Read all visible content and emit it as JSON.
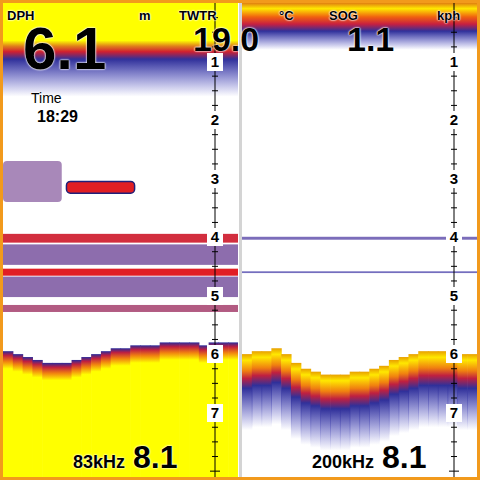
{
  "readouts": [
    {
      "label": "DPH",
      "value": "6.1",
      "unit": "m"
    },
    {
      "label": "TWTR",
      "value": "19.0",
      "unit": "°C"
    },
    {
      "label": "SOG",
      "value": "1.1",
      "unit": "kph"
    }
  ],
  "time": {
    "label": "Time",
    "value": "18:29"
  },
  "panels": [
    {
      "frequency": "83kHz",
      "range": "8.1",
      "scale": [
        "1",
        "2",
        "3",
        "4",
        "5",
        "6",
        "7"
      ],
      "surface_depth": 1.6,
      "bottom": [
        5.95,
        6.0,
        6.05,
        6.1,
        6.15,
        6.15,
        6.15,
        6.1,
        6.05,
        6.0,
        5.95,
        5.9,
        5.9,
        5.85,
        5.85,
        5.85,
        5.8,
        5.8,
        5.8,
        5.8,
        5.85,
        5.8,
        5.8,
        5.8
      ],
      "bottom_thickness": 2.5,
      "layers": [
        {
          "depth": 4.02,
          "thickness": 0.15,
          "strength": 0.9
        },
        {
          "depth": 4.3,
          "thickness": 0.35,
          "strength": 0.25
        },
        {
          "depth": 4.6,
          "thickness": 0.12,
          "strength": 1.0
        },
        {
          "depth": 4.85,
          "thickness": 0.35,
          "strength": 0.25
        },
        {
          "depth": 5.22,
          "thickness": 0.12,
          "strength": 0.6
        }
      ],
      "targets": [
        {
          "from": 0.0,
          "to": 0.25,
          "depth": 3.05,
          "thickness": 0.7,
          "strength": 0.3
        },
        {
          "from": 0.27,
          "to": 0.56,
          "depth": 3.15,
          "thickness": 0.2,
          "strength": 1.0
        }
      ]
    },
    {
      "frequency": "200kHz",
      "range": "8.1",
      "scale": [
        "1",
        "2",
        "3",
        "4",
        "5",
        "6",
        "7"
      ],
      "surface_depth": 0.8,
      "bottom": [
        6.0,
        5.95,
        5.95,
        5.9,
        6.0,
        6.15,
        6.25,
        6.3,
        6.35,
        6.35,
        6.35,
        6.3,
        6.3,
        6.25,
        6.2,
        6.1,
        6.05,
        6.0,
        5.95,
        5.95,
        5.95,
        5.95,
        6.0,
        6.0
      ],
      "bottom_thickness": 1.3,
      "layers": [
        {
          "depth": 4.02,
          "thickness": 0.05,
          "strength": 0.1
        },
        {
          "depth": 4.6,
          "thickness": 0.03,
          "strength": 0.05
        }
      ],
      "targets": []
    }
  ]
}
